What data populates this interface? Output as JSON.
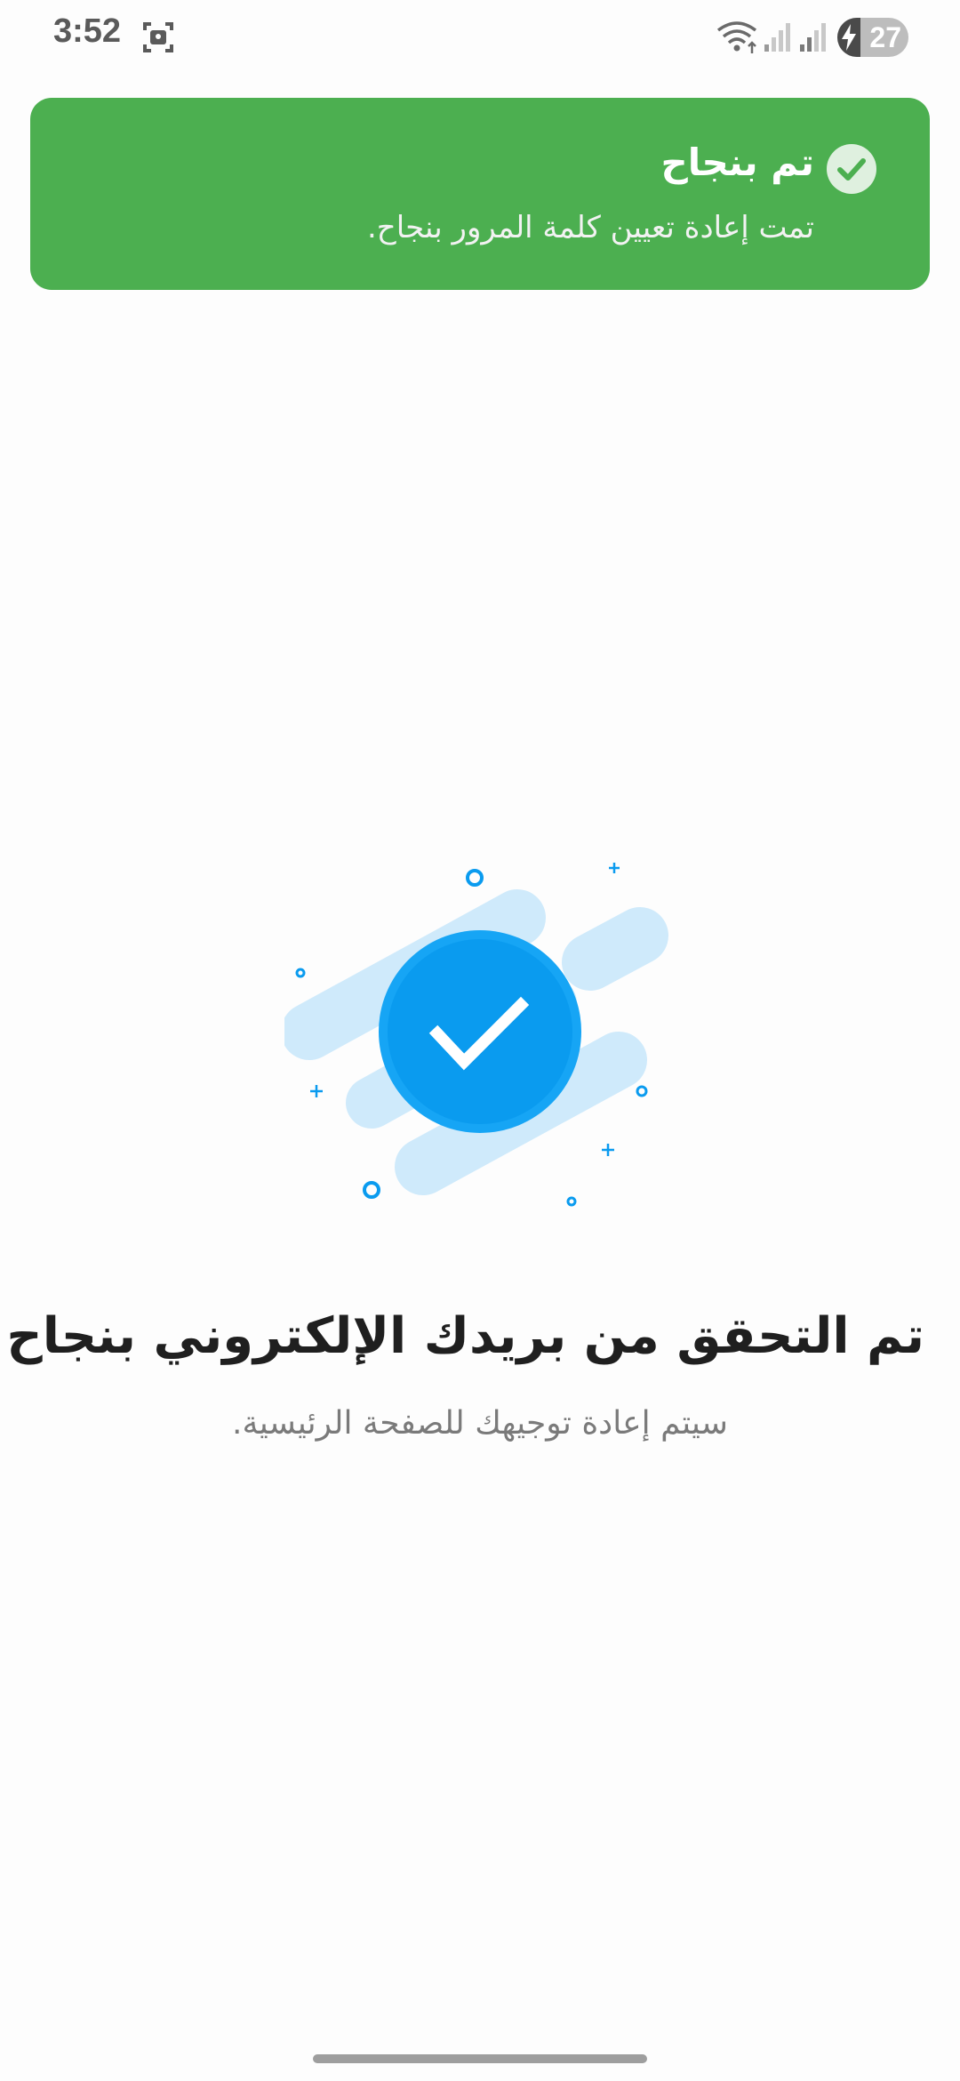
{
  "status_bar": {
    "time": "3:52",
    "battery_level": "27",
    "icons": [
      "screenshot-icon",
      "wifi-icon",
      "signal-icon",
      "signal-icon",
      "battery-charging-icon"
    ]
  },
  "toast": {
    "title": "تم بنجاح",
    "message": "تمت إعادة تعيين كلمة المرور بنجاح.",
    "icon": "check-circle-icon",
    "color": "#4caf50"
  },
  "illustration": {
    "icon": "success-check-icon",
    "accent": "#0a9bef",
    "light_accent": "#cfeafb"
  },
  "main": {
    "title": "تم التحقق من بريدك الإلكتروني بنجاح",
    "subtitle": "سيتم إعادة توجيهك للصفحة الرئيسية."
  }
}
